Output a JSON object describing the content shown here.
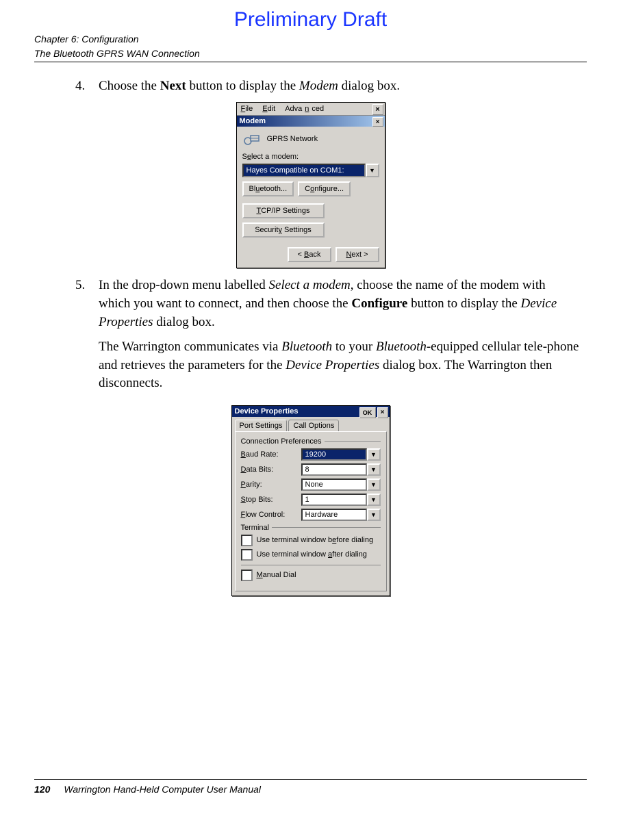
{
  "draft": "Preliminary Draft",
  "header": {
    "chapter": "Chapter 6:  Configuration",
    "section": "The Bluetooth GPRS WAN Connection"
  },
  "steps": {
    "s4": {
      "num": "4.",
      "pre": "Choose the ",
      "bold": "Next",
      "mid": " button to display the ",
      "ital": "Modem",
      "post": " dialog box."
    },
    "s5": {
      "num": "5.",
      "t1": "In the drop-down menu labelled ",
      "i1": "Select a modem",
      "t2": ", choose the name of the modem with which you want to connect, and then choose the ",
      "b1": "Configure",
      "t3": " button to display the ",
      "i2": "Device Properties",
      "t4": " dialog box."
    },
    "note": {
      "t1": "The Warrington communicates via ",
      "i1": "Bluetooth",
      "t2": " to your ",
      "i2": "Bluetooth",
      "t3": "-equipped cellular tele-phone and retrieves the parameters for the ",
      "i3": "Device Properties",
      "t4": " dialog box. The Warrington then disconnects."
    }
  },
  "dlg1": {
    "menu": {
      "file": "File",
      "edit": "Edit",
      "adv": "Advanced",
      "adv_u": "n"
    },
    "title": "Modem",
    "network": "GPRS Network",
    "select_label_pre": "S",
    "select_label_u": "e",
    "select_label_post": "lect a modem:",
    "combo_value": "Hayes Compatible on COM1:",
    "bluetooth_pre": "Bl",
    "bluetooth_u": "u",
    "bluetooth_post": "etooth...",
    "configure_pre": "C",
    "configure_u": "o",
    "configure_post": "nfigure...",
    "tcpip_u": "T",
    "tcpip_post": "CP/IP Settings",
    "security_pre": "Securit",
    "security_u": "y",
    "security_post": " Settings",
    "back_pre": "< ",
    "back_u": "B",
    "back_post": "ack",
    "next_u": "N",
    "next_post": "ext >"
  },
  "dlg2": {
    "title": "Device Properties",
    "ok": "OK",
    "tabs": {
      "port": "Port Settings",
      "call": "Call Options"
    },
    "group_conn": "Connection Preferences",
    "baud_label_u": "B",
    "baud_label_post": "aud Rate:",
    "data_label_u": "D",
    "data_label_post": "ata Bits:",
    "parity_label_u": "P",
    "parity_label_post": "arity:",
    "stop_label_u": "S",
    "stop_label_post": "top Bits:",
    "flow_label_u": "F",
    "flow_label_post": "low Control:",
    "baud": "19200",
    "databits": "8",
    "parity": "None",
    "stopbits": "1",
    "flow": "Hardware",
    "group_term": "Terminal",
    "chk_before_pre": "Use terminal window b",
    "chk_before_u": "e",
    "chk_before_post": "fore dialing",
    "chk_after_pre": "Use terminal window ",
    "chk_after_u": "a",
    "chk_after_post": "fter dialing",
    "manual_u": "M",
    "manual_post": "anual Dial"
  },
  "footer": {
    "page": "120",
    "text": "Warrington Hand-Held Computer User Manual"
  }
}
